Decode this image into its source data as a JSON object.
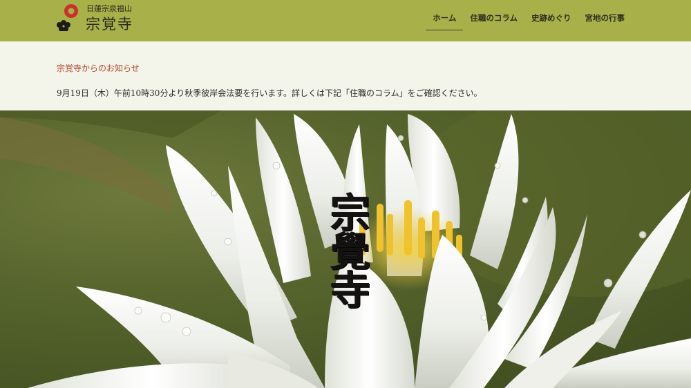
{
  "header": {
    "logo_subtitle": "日蓮宗泉福山",
    "logo_title": "宗覚寺",
    "nav": [
      {
        "label": "ホーム",
        "active": true
      },
      {
        "label": "住職のコラム",
        "active": false
      },
      {
        "label": "史跡めぐり",
        "active": false
      },
      {
        "label": "宮地の行事",
        "active": false
      }
    ]
  },
  "notice": {
    "title": "宗覚寺からのお知らせ",
    "body": "9月19日（木）午前10時30分より秋季彼岸会法要を行います。詳しくは下記「住職のコラム」をご確認ください。"
  },
  "hero": {
    "calligraphy": "宗覺寺",
    "image": "white-water-lily-photo"
  },
  "colors": {
    "header_bg": "#a8b04a",
    "notice_bg": "#f4f5ea",
    "notice_title": "#b4452e"
  }
}
